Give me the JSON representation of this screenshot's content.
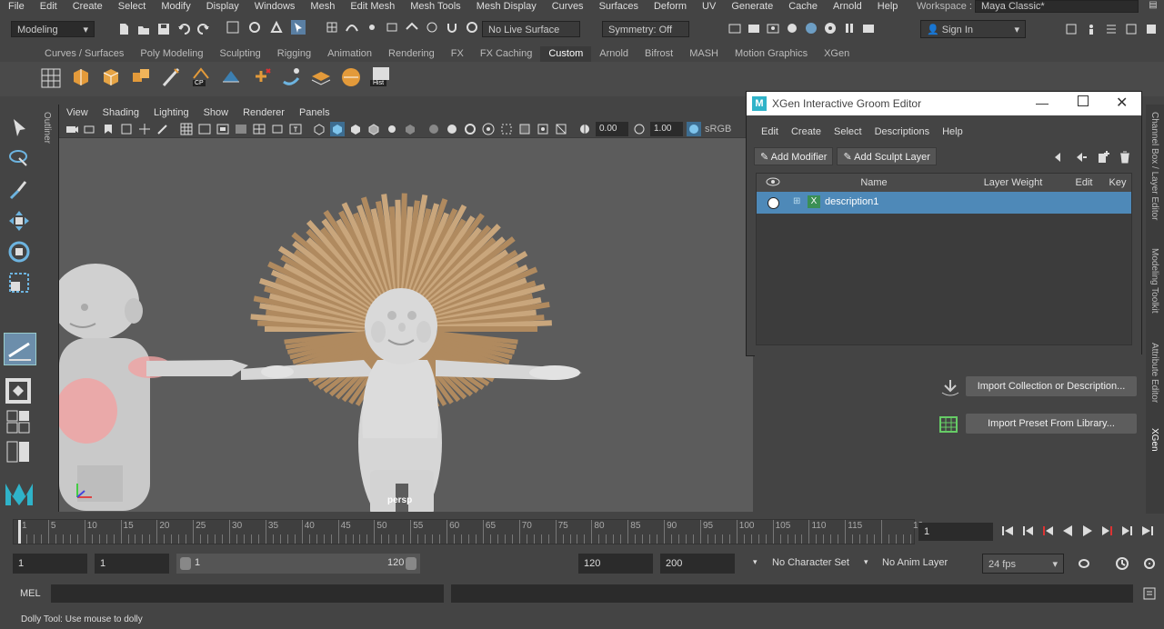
{
  "menubar": [
    "File",
    "Edit",
    "Create",
    "Select",
    "Modify",
    "Display",
    "Windows",
    "Mesh",
    "Edit Mesh",
    "Mesh Tools",
    "Mesh Display",
    "Curves",
    "Surfaces",
    "Deform",
    "UV",
    "Generate",
    "Cache",
    "Arnold",
    "Help"
  ],
  "workspace": {
    "label": "Workspace :",
    "value": "Maya Classic*"
  },
  "status": {
    "mode": "Modeling",
    "live_surface": "No Live Surface",
    "symmetry": "Symmetry: Off",
    "sign_in": "Sign In"
  },
  "shelf_tabs": [
    "Curves / Surfaces",
    "Poly Modeling",
    "Sculpting",
    "Rigging",
    "Animation",
    "Rendering",
    "FX",
    "FX Caching",
    "Custom",
    "Arnold",
    "Bifrost",
    "MASH",
    "Motion Graphics",
    "XGen"
  ],
  "shelf_selected": "Custom",
  "shelf_badges": {
    "cp": "CP",
    "hist": "Hist"
  },
  "viewport": {
    "menus": [
      "View",
      "Shading",
      "Lighting",
      "Show",
      "Renderer",
      "Panels"
    ],
    "near": "0.00",
    "far": "1.00",
    "colorspace": "sRGB",
    "camera": "persp"
  },
  "outliner_label": "Outliner",
  "xgen": {
    "title": "XGen Interactive Groom Editor",
    "menus": [
      "Edit",
      "Create",
      "Select",
      "Descriptions",
      "Help"
    ],
    "add_modifier": "Add Modifier",
    "add_sculpt_layer": "Add Sculpt Layer",
    "columns": [
      "Name",
      "Layer Weight",
      "Edit",
      "Key"
    ],
    "rows": [
      {
        "name": "description1"
      }
    ]
  },
  "right_panel": {
    "import_collection": "Import Collection or Description...",
    "import_preset": "Import Preset From Library..."
  },
  "vertical_tabs": [
    "Channel Box / Layer Editor",
    "Modeling Toolkit",
    "Attribute Editor",
    "XGen"
  ],
  "timeline": {
    "ticks": [
      "1",
      "5",
      "10",
      "15",
      "20",
      "25",
      "30",
      "35",
      "40",
      "45",
      "50",
      "55",
      "60",
      "65",
      "70",
      "75",
      "80",
      "85",
      "90",
      "95",
      "100",
      "105",
      "110",
      "115",
      "12"
    ],
    "current": "1"
  },
  "range": {
    "start": "1",
    "anim_start": "1",
    "slider_start": "1",
    "slider_end": "120",
    "end": "120",
    "anim_end": "200",
    "char_set": "No Character Set",
    "anim_layer": "No Anim Layer",
    "fps": "24 fps"
  },
  "cmd": {
    "label": "MEL"
  },
  "help": "Dolly Tool: Use mouse to dolly",
  "colors": {
    "accent": "#4e89b8",
    "hair": "#b08a5f"
  }
}
